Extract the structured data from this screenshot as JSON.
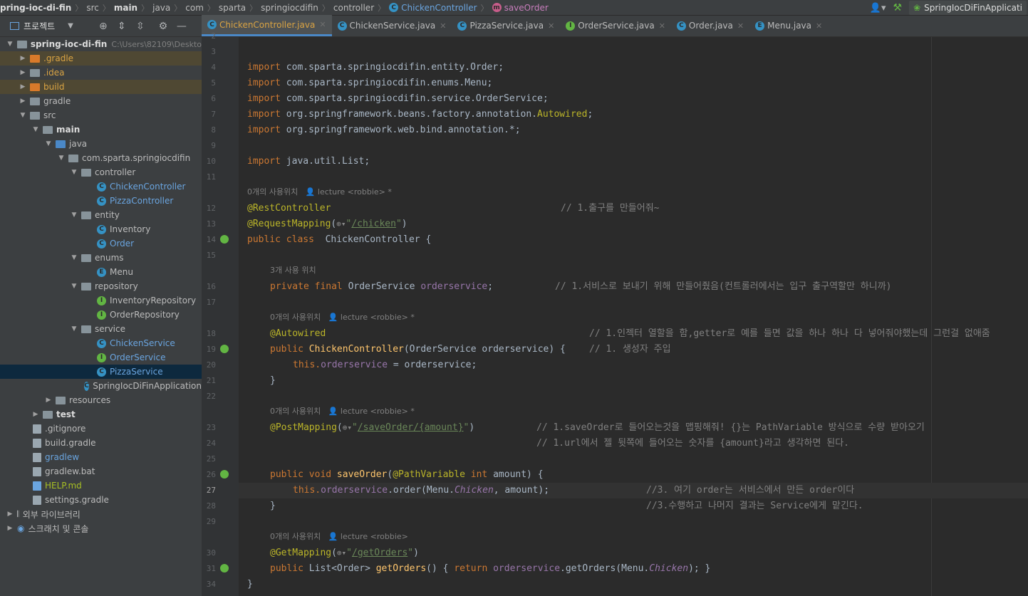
{
  "breadcrumb": {
    "items": [
      "pring-ioc-di-fin",
      "src",
      "main",
      "java",
      "com",
      "sparta",
      "springiocdifin",
      "controller",
      "ChickenController",
      "saveOrder"
    ],
    "run_config": "SpringIocDiFinApplicati"
  },
  "project_toolbar": {
    "title": "프로젝트"
  },
  "tabs": [
    {
      "label": "ChickenController.java",
      "icon": "C",
      "active": true
    },
    {
      "label": "ChickenService.java",
      "icon": "C"
    },
    {
      "label": "PizzaService.java",
      "icon": "C"
    },
    {
      "label": "OrderService.java",
      "icon": "I"
    },
    {
      "label": "Order.java",
      "icon": "C"
    },
    {
      "label": "Menu.java",
      "icon": "E"
    }
  ],
  "tree": {
    "root": "spring-ioc-di-fin",
    "root_path": "C:\\Users\\82109\\Deskto",
    "items": [
      ".gradle",
      ".idea",
      "build",
      "gradle",
      "src",
      "main",
      "java",
      "com.sparta.springiocdifin",
      "controller",
      "ChickenController",
      "PizzaController",
      "entity",
      "Inventory",
      "Order",
      "enums",
      "Menu",
      "repository",
      "InventoryRepository",
      "OrderRepository",
      "service",
      "ChickenService",
      "OrderService",
      "PizzaService",
      "SpringIocDiFinApplication",
      "resources",
      "test",
      ".gitignore",
      "build.gradle",
      "gradlew",
      "gradlew.bat",
      "HELP.md",
      "settings.gradle",
      "외부 라이브러리",
      "스크래치 및 콘솔"
    ]
  },
  "editor": {
    "line_numbers": [
      "2",
      "3",
      "4",
      "5",
      "6",
      "7",
      "8",
      "9",
      "10",
      "11",
      "12",
      "13",
      "14",
      "15",
      "16",
      "17",
      "18",
      "19",
      "20",
      "21",
      "22",
      "23",
      "24",
      "25",
      "26",
      "27",
      "28",
      "29",
      "30",
      "31",
      "34"
    ],
    "hints": {
      "h1": "0개의 사용위치",
      "h2": "3개 사용 위치",
      "h3": "0개의 사용위치",
      "h4": "0개의 사용위치",
      "h5": "0개의 사용위치",
      "author": "lecture <robbie> *",
      "author_plain": "lecture <robbie>"
    },
    "code": {
      "imp1_kw": "import",
      "imp1": " com.sparta.springiocdifin.entity.Order;",
      "imp2_kw": "import",
      "imp2": " com.sparta.springiocdifin.enums.Menu;",
      "imp3_kw": "import",
      "imp3": " com.sparta.springiocdifin.service.OrderService;",
      "imp4_kw": "import",
      "imp4a": " org.springframework.beans.factory.annotation.",
      "imp4b": "Autowired",
      "imp4c": ";",
      "imp5_kw": "import",
      "imp5": " org.springframework.web.bind.annotation.*;",
      "imp6_kw": "import",
      "imp6": " java.util.List;",
      "l12_ann": "@RestController",
      "l12_cmt": "// 1.출구를 만들어줘~",
      "l13_ann": "@RequestMapping",
      "l13_url": "/chicken",
      "l14": "public class  ChickenController {",
      "l16_kw": "private final ",
      "l16_type": "OrderService ",
      "l16_fld": "orderservice",
      "l16_end": ";",
      "l16_cmt": "// 1.서비스로 보내기 위해 만들어줬음(컨트롤러에서는 입구 출구역할만 하니까)",
      "l18_ann": "@Autowired",
      "l18_cmt": "// 1.인젝터 열할을 함,getter로 예를 들면 값을 하나 하나 다 넣어줘야했는데 그런걸 없애줌",
      "l19_kw": "public ",
      "l19_fn": "ChickenController",
      "l19_rest": "(OrderService orderservice) {",
      "l19_cmt": "// 1. 생성자 주입",
      "l20_kw": "this.",
      "l20_fld": "orderservice",
      "l20_rest": " = orderservice;",
      "l21": "}",
      "l23_ann": "@PostMapping",
      "l23_url": "/saveOrder/{amount}",
      "l23_cmt": "// 1.saveOrder로 들어오는것을 맵핑해줘! {}는 PathVariable 방식으로 수량 받아오기",
      "l24_cmt": "// 1.url에서 젤 뒷쪽에 들어오는 숫자를 {amount}라고 생각하면 된다.",
      "l26_kw": "public void ",
      "l26_fn": "saveOrder",
      "l26_ann": "@PathVariable ",
      "l26_kw2": "int ",
      "l26_rest": "amount) {",
      "l27_kw": "this.",
      "l27_fld": "orderservice",
      "l27_mid": ".order(Menu.",
      "l27_it": "Chicken",
      "l27_rest": ", amount);",
      "l27_cmt": "//3. 여기 order는 서비스에서 만든 order이다",
      "l28": "}",
      "l28_cmt": "//3.수행하고 나머지 결과는 Service에게 맡긴다.",
      "l30_ann": "@GetMapping",
      "l30_url": "/getOrders",
      "l31_kw": "public ",
      "l31_type": "List<Order> ",
      "l31_fn": "getOrders",
      "l31_mid": "() { ",
      "l31_kw2": "return ",
      "l31_fld": "orderservice",
      "l31_mid2": ".getOrders(Menu.",
      "l31_it": "Chicken",
      "l31_end": "); }",
      "l34": "}"
    }
  },
  "colors": {
    "accent": "#4a88c7",
    "keyword": "#cc7832",
    "annotation": "#bbb529",
    "string": "#6a8759",
    "field": "#9876aa",
    "function": "#ffc66d"
  }
}
